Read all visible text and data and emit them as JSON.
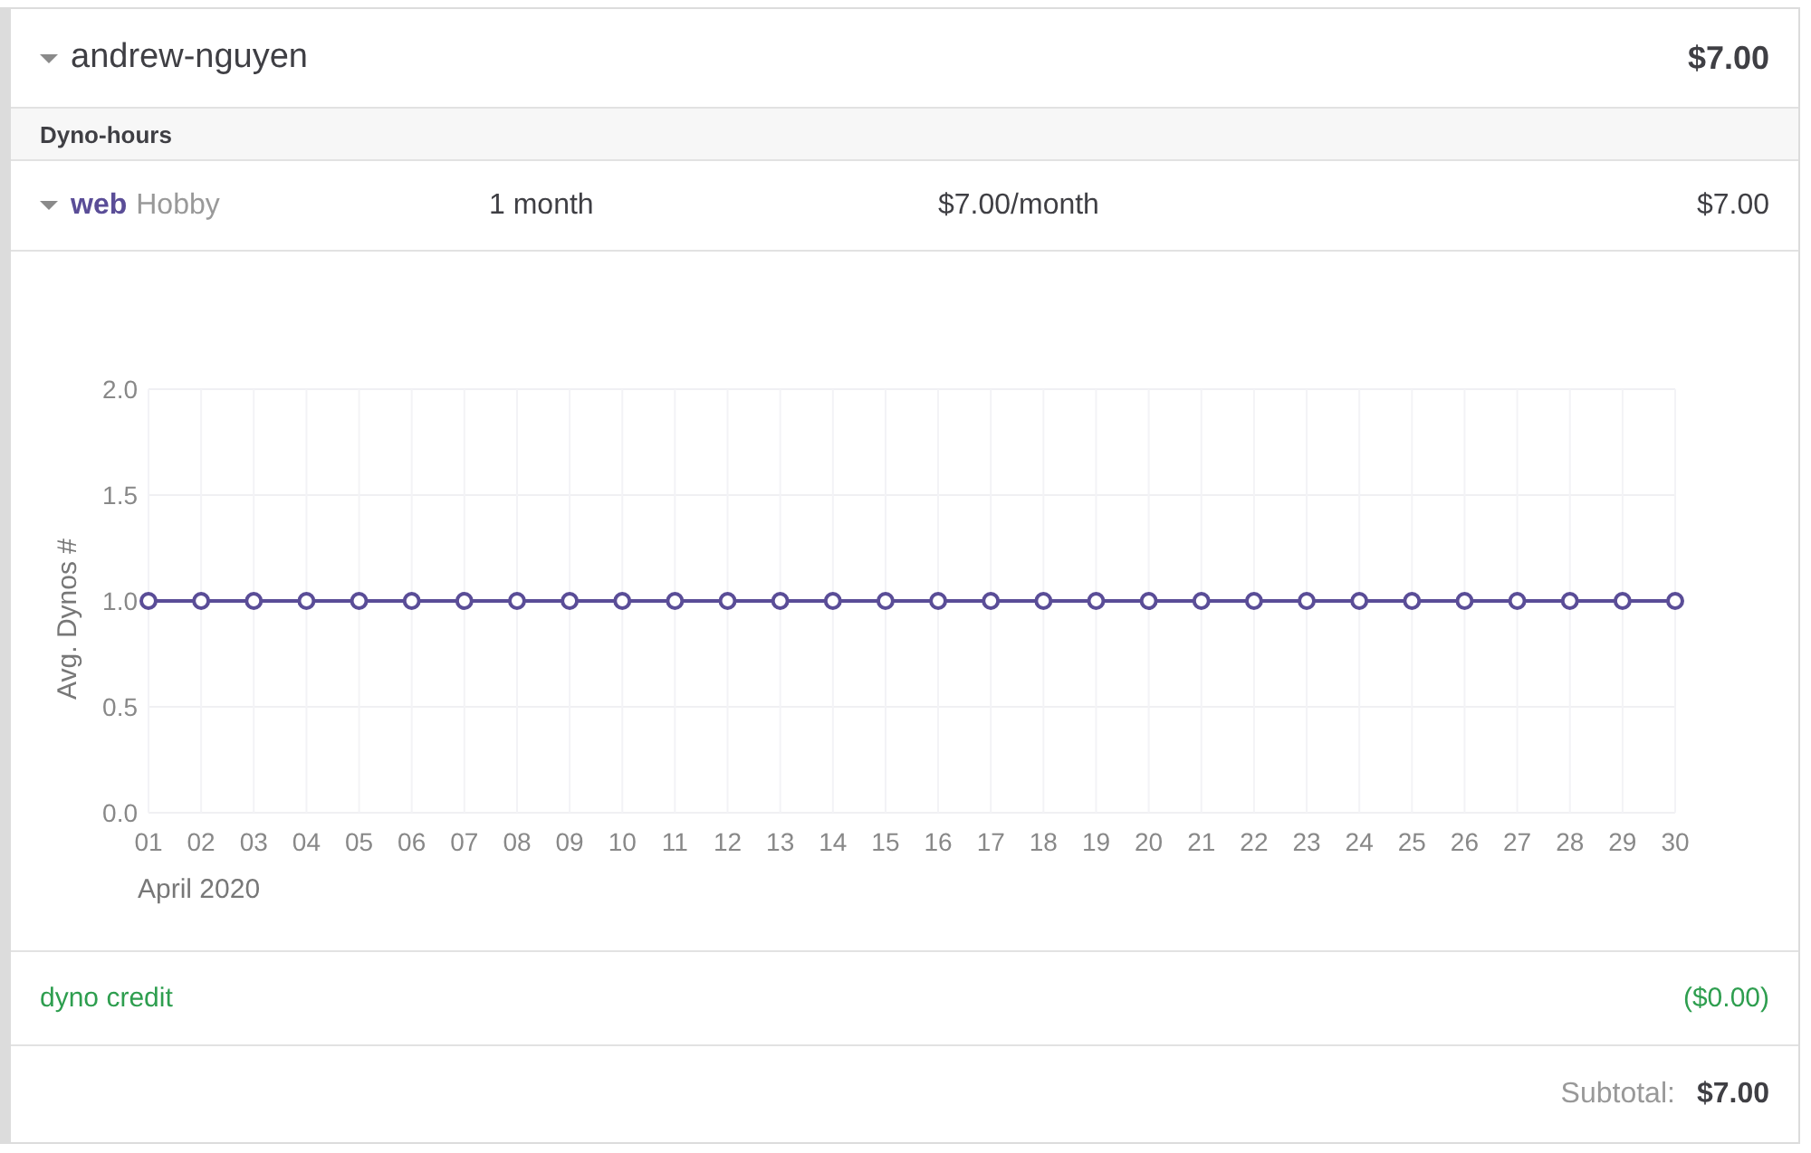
{
  "account": {
    "name": "andrew-nguyen",
    "expanded": true,
    "total": "$7.00"
  },
  "section": {
    "title": "Dyno-hours"
  },
  "dyno": {
    "name": "web",
    "tier": "Hobby",
    "expanded": true,
    "duration": "1 month",
    "rate": "$7.00/month",
    "amount": "$7.00"
  },
  "usage_chart": {
    "chart_data": {
      "type": "line",
      "xlabel": "April 2020",
      "ylabel": "Avg. Dynos #",
      "categories": [
        "01",
        "02",
        "03",
        "04",
        "05",
        "06",
        "07",
        "08",
        "09",
        "10",
        "11",
        "12",
        "13",
        "14",
        "15",
        "16",
        "17",
        "18",
        "19",
        "20",
        "21",
        "22",
        "23",
        "24",
        "25",
        "26",
        "27",
        "28",
        "29",
        "30"
      ],
      "grid": true,
      "series": [
        {
          "color": "#5a4d97",
          "marker": "circle",
          "values": [
            1,
            1,
            1,
            1,
            1,
            1,
            1,
            1,
            1,
            1,
            1,
            1,
            1,
            1,
            1,
            1,
            1,
            1,
            1,
            1,
            1,
            1,
            1,
            1,
            1,
            1,
            1,
            1,
            1,
            1
          ]
        }
      ],
      "ylim": [
        0,
        2
      ],
      "yticks": [
        {
          "value": 0,
          "label": "0.0"
        },
        {
          "value": 0.5,
          "label": "0.5"
        },
        {
          "value": 1,
          "label": "1.0"
        },
        {
          "value": 1.5,
          "label": "1.5"
        },
        {
          "value": 2,
          "label": "2.0"
        }
      ]
    }
  },
  "credit": {
    "label": "dyno credit",
    "amount": "($0.00)"
  },
  "subtotal": {
    "label": "Subtotal:",
    "amount": "$7.00"
  }
}
